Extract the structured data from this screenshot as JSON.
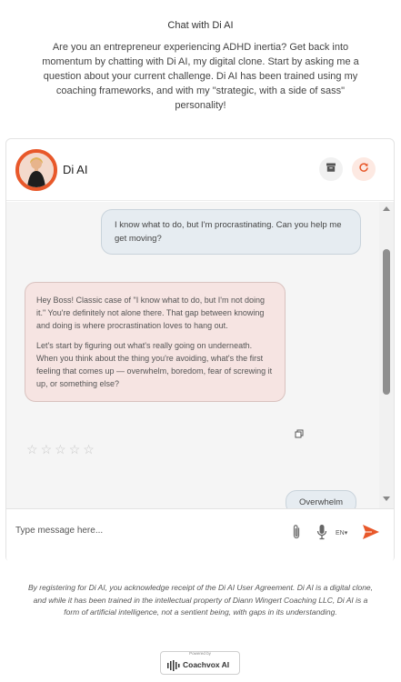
{
  "page": {
    "title": "Chat with Di AI",
    "intro": "Are you an entrepreneur experiencing ADHD inertia?  Get back into momentum by chatting with Di AI, my digital clone.  Start by asking me a question about your current challenge.  Di AI has been trained using my coaching frameworks,  and with my \"strategic, with a side of sass\" personality!"
  },
  "chat": {
    "bot_name": "Di AI",
    "messages": [
      {
        "role": "user",
        "text": "I know what to do, but I'm procrastinating.  Can you help me get moving?"
      },
      {
        "role": "assistant",
        "paragraphs": [
          "Hey Boss! Classic case of \"I know what to do, but I'm not doing it.\" You're definitely not alone there. That gap between knowing and doing is where procrastination loves to hang out.",
          "Let's start by figuring out what's really going on underneath. When you think about the thing you're avoiding, what's the first feeling that comes up — overwhelm, boredom, fear of screwing it up, or something else?"
        ],
        "rating": {
          "max": 5,
          "value": 0
        }
      }
    ],
    "suggestion": "Overwhelm"
  },
  "composer": {
    "placeholder": "Type message here...",
    "language": "EN"
  },
  "footer": {
    "disclaimer": "By registering for Di AI, you acknowledge receipt of the Di AI User Agreement.  Di AI is a digital clone,  and while it has been trained in the intellectual property of Diann Wingert Coaching LLC,  Di AI is a form of artificial intelligence,  not a sentient being, with gaps in its understanding.",
    "powered_by": "Powered by",
    "brand": "Coachvox AI"
  },
  "colors": {
    "accent": "#e8582a",
    "user_bubble": "#e6ecf1",
    "bot_bubble": "#f6e4e2"
  },
  "icons": [
    "archive-icon",
    "refresh-icon",
    "copy-icon",
    "star-icon",
    "paperclip-icon",
    "microphone-icon",
    "chevron-down-icon",
    "send-icon"
  ]
}
